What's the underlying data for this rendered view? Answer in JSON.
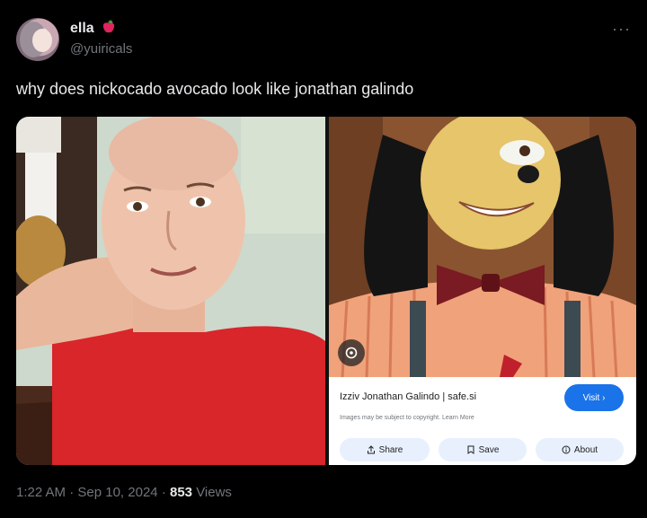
{
  "author": {
    "name": "ella",
    "handle": "@yuiricals",
    "name_emoji_icon": "apple-icon"
  },
  "tweet": {
    "text": "why does nickocado avocado look like jonathan galindo"
  },
  "lens_result": {
    "source_title": "Izziv Jonathan Galindo | safe.si",
    "disclaimer": "Images may be subject to copyright. Learn More",
    "visit_label": "Visit ›",
    "share_label": "Share",
    "save_label": "Save",
    "about_label": "About"
  },
  "meta": {
    "time": "1:22 AM",
    "date": "Sep 10, 2024",
    "views_count": "853",
    "views_label": "Views",
    "separator": "·"
  },
  "colors": {
    "background": "#000000",
    "primary_text": "#e7e9ea",
    "secondary_text": "#71767b",
    "visit_button": "#1a73e8",
    "tshirt_red": "#d8262b"
  }
}
